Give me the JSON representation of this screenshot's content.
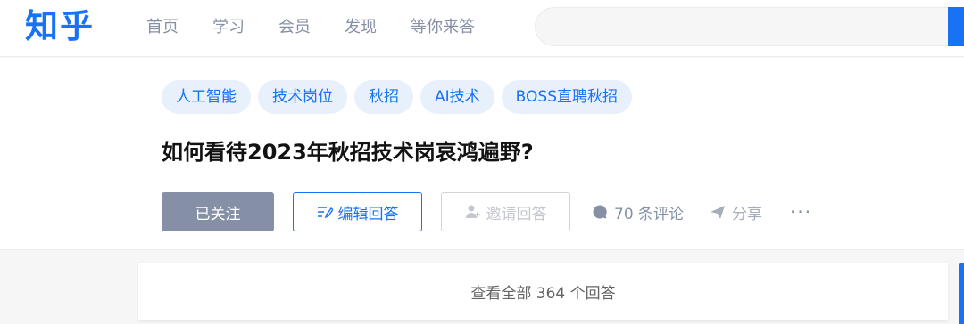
{
  "header": {
    "logo": "知乎",
    "nav": [
      "首页",
      "学习",
      "会员",
      "发现",
      "等你来答"
    ],
    "search_placeholder": ""
  },
  "question": {
    "topics": [
      "人工智能",
      "技术岗位",
      "秋招",
      "AI技术",
      "BOSS直聘秋招"
    ],
    "title": "如何看待2023年秋招技术岗哀鸿遍野?",
    "follow_label": "已关注",
    "edit_label": "编辑回答",
    "invite_label": "邀请回答",
    "comments_label": "70 条评论",
    "share_label": "分享",
    "more_label": "···"
  },
  "answers": {
    "view_all_label": "查看全部 364 个回答"
  },
  "colors": {
    "brand": "#1772f6",
    "muted": "#8590a6"
  }
}
